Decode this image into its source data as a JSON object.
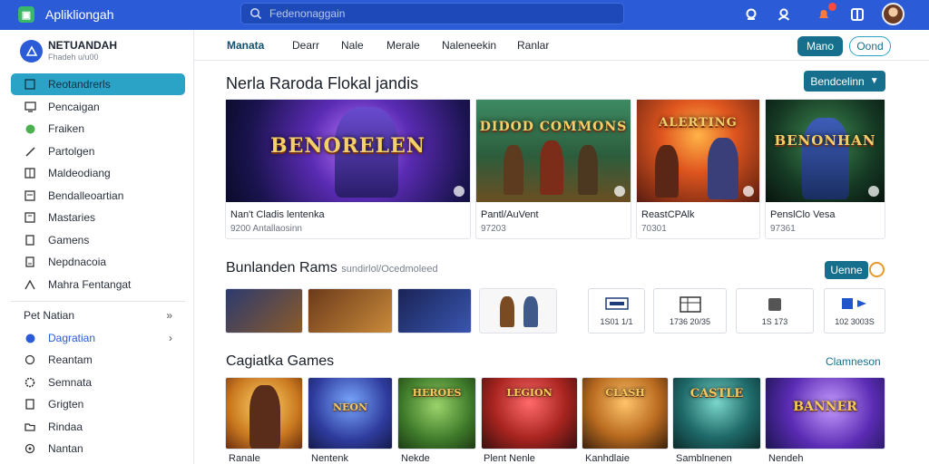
{
  "topbar": {
    "app_title": "Aplikliongah",
    "search_placeholder": "Fedenonaggain"
  },
  "sidebar": {
    "profile_name": "NETUANDAH",
    "profile_sub": "Fhadeh u/u00",
    "items": [
      {
        "label": "Reotandrerls",
        "icon": "list-icon"
      },
      {
        "label": "Pencaigan",
        "icon": "monitor-icon"
      },
      {
        "label": "Fraiken",
        "icon": "puzzle-icon"
      },
      {
        "label": "Partolgen",
        "icon": "pencil-icon"
      },
      {
        "label": "Maldeodiang",
        "icon": "grid-icon"
      },
      {
        "label": "Bendalleoartian",
        "icon": "document-icon"
      },
      {
        "label": "Mastaries",
        "icon": "book-icon"
      },
      {
        "label": "Gamens",
        "icon": "file-icon"
      },
      {
        "label": "Nepdnacoia",
        "icon": "page-icon"
      },
      {
        "label": "Mahra Fentangat",
        "icon": "person-icon"
      }
    ],
    "items2": [
      {
        "label": "Pet Natian"
      },
      {
        "label": "Dagratian"
      },
      {
        "label": "Reantam"
      },
      {
        "label": "Semnata"
      },
      {
        "label": "Grigten"
      },
      {
        "label": "Rindaa"
      },
      {
        "label": "Nantan"
      }
    ]
  },
  "subnav": {
    "tabs": [
      "Manata",
      "Dearr",
      "Nale",
      "Merale",
      "Naleneekin",
      "Ranlar"
    ],
    "primary_btn": "Mano",
    "outline_btn": "Oond"
  },
  "featured": {
    "title": "Nerla Raroda Flokal jandis",
    "dropdown": "Bendcelinn",
    "cards": [
      {
        "art_text": "BENORELEN",
        "title": "Nan't Cladis lentenka",
        "sub": "9200 Antallaosinn"
      },
      {
        "art_text": "DIDOD COMMONS",
        "title": "Pantl/AuVent",
        "sub": "97203"
      },
      {
        "art_text": "ALERTING",
        "title": "ReastCPAlk",
        "sub": "70301"
      },
      {
        "art_text": "BENONHAN",
        "title": "PenslClo Vesa",
        "sub": "97361"
      }
    ]
  },
  "recommended": {
    "title": "Bunlanden Rams",
    "subtitle": "sundirlol/Ocedmoleed",
    "more_btn": "Uenne",
    "tiles": [
      {
        "label": "1S01 1/1"
      },
      {
        "label": "1736 20/35"
      },
      {
        "label": "1S 173"
      },
      {
        "label": "102 3003S"
      }
    ]
  },
  "grid": {
    "title": "Cagiatka Games",
    "link": "Clamneson",
    "items": [
      {
        "label": "Ranale"
      },
      {
        "label": "Nentenk"
      },
      {
        "label": "Nekde"
      },
      {
        "label": "Plent Nenle"
      },
      {
        "label": "Kanhdlaie"
      },
      {
        "label": "Samblnenen"
      },
      {
        "label": "Nendeh"
      }
    ]
  },
  "colors": {
    "topbar": "#2b5bd6",
    "accent": "#176f8e",
    "active_nav": "#2aa3c7"
  }
}
